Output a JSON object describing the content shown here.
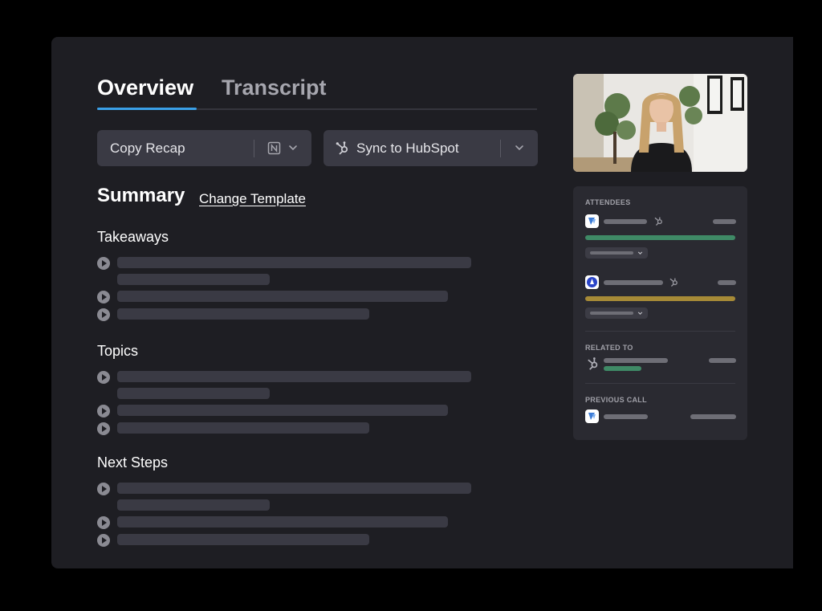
{
  "tabs": {
    "overview": "Overview",
    "transcript": "Transcript"
  },
  "actions": {
    "copy_recap": "Copy Recap",
    "sync_hubspot": "Sync to HubSpot"
  },
  "summary": {
    "title": "Summary",
    "change_template": "Change Template",
    "sections": {
      "takeaways": "Takeaways",
      "topics": "Topics",
      "next_steps": "Next Steps"
    }
  },
  "sidebar": {
    "attendees_label": "ATTENDEES",
    "related_to_label": "RELATED TO",
    "previous_call_label": "PREVIOUS CALL"
  },
  "colors": {
    "background": "#000000",
    "panel": "#1e1e23",
    "card": "#2a2a31",
    "tab_accent": "#3aa0e8",
    "attendee_1_bar": "#3f8a66",
    "attendee_2_bar": "#a68a37",
    "related_bar": "#3f8a66"
  },
  "icons": {
    "copy_recap": [
      "notion-icon",
      "chevron-down-icon"
    ],
    "sync": [
      "hubspot-icon",
      "chevron-down-icon"
    ],
    "list_items": "play-icon"
  }
}
